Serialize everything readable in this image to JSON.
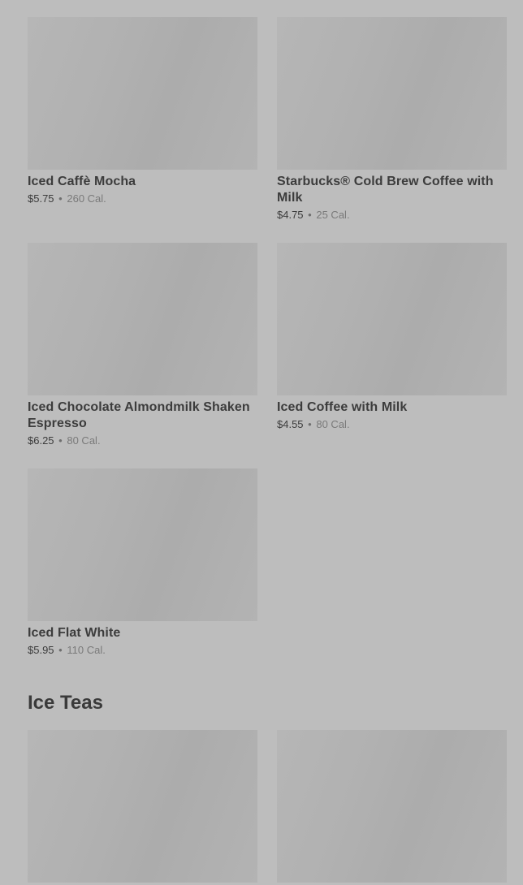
{
  "menu": {
    "items": [
      {
        "name": "Iced Caffè Mocha",
        "price": "$5.75",
        "separator": "•",
        "calories": "260 Cal."
      },
      {
        "name": "Starbucks® Cold Brew Coffee with Milk",
        "price": "$4.75",
        "separator": "•",
        "calories": "25 Cal."
      },
      {
        "name": "Iced Chocolate Almondmilk Shaken Espresso",
        "price": "$6.25",
        "separator": "•",
        "calories": "80 Cal."
      },
      {
        "name": "Iced Coffee with Milk",
        "price": "$4.55",
        "separator": "•",
        "calories": "80 Cal."
      },
      {
        "name": "Iced Flat White",
        "price": "$5.95",
        "separator": "•",
        "calories": "110 Cal."
      }
    ]
  },
  "sections": {
    "ice_teas": {
      "title": "Ice Teas"
    }
  }
}
